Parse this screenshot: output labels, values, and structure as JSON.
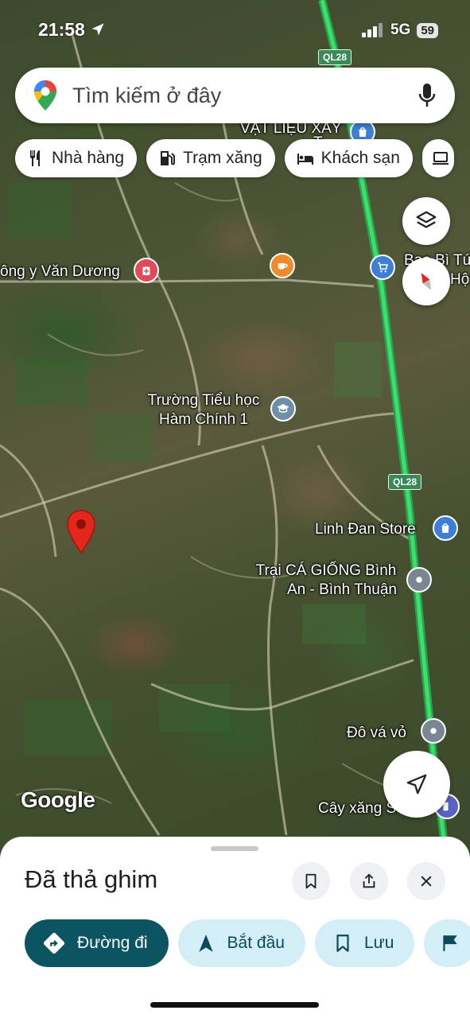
{
  "status_bar": {
    "time": "21:58",
    "network": "5G",
    "battery": "59"
  },
  "search": {
    "placeholder": "Tìm kiếm ở đây"
  },
  "categories": [
    {
      "label": "Nhà hàng",
      "icon": "restaurant-icon"
    },
    {
      "label": "Trạm xăng",
      "icon": "gas-station-icon"
    },
    {
      "label": "Khách sạn",
      "icon": "hotel-icon"
    }
  ],
  "map": {
    "road_shield_top": "QL28",
    "road_shield_mid": "QL28",
    "labels": {
      "vat_lieu": "VẬT LIỆU XÂY",
      "vat_lieu_sub": "T",
      "dong_y": "ông y Văn Dương",
      "bao_bi": "Bao Bì Tú",
      "bao_bi_sub": "Hộ",
      "school_line1": "Trường Tiểu học",
      "school_line2": "Hàm Chính 1",
      "linh_dan": "Linh Đan Store",
      "trai_ca_line1": "Trại CÁ GIỐNG Bình",
      "trai_ca_line2": "An - Bình Thuận",
      "do_va_vo": "Đô vá vỏ",
      "cay_xang": "Cây xăng S"
    },
    "attribution": "Google"
  },
  "sheet": {
    "title": "Đã thả ghim",
    "actions": [
      {
        "label": "Đường đi",
        "icon": "directions-icon"
      },
      {
        "label": "Bắt đầu",
        "icon": "navigation-arrow-icon"
      },
      {
        "label": "Lưu",
        "icon": "bookmark-icon"
      }
    ]
  },
  "colors": {
    "primary_action": "#0b5563",
    "secondary_action": "#d3eef6",
    "pin": "#e3271c",
    "highway": "#39e06b"
  }
}
